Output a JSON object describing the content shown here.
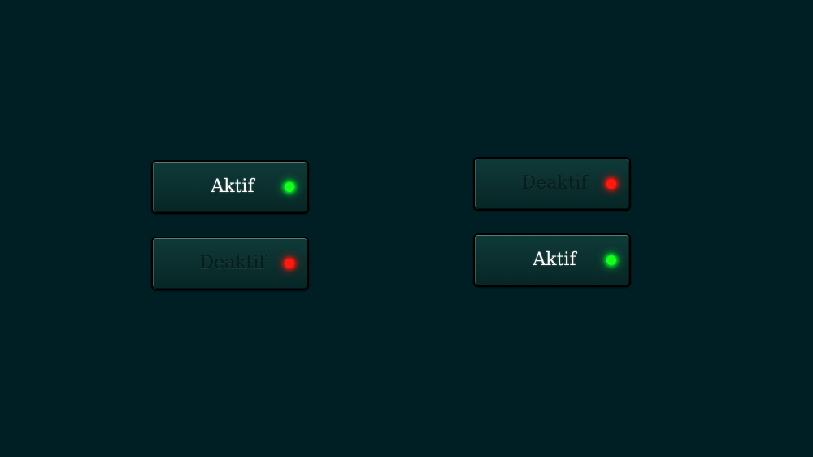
{
  "buttons": [
    {
      "label": "Aktif",
      "state": "active",
      "indicator": "green-led-icon",
      "color": "#16ff1c"
    },
    {
      "label": "Deaktif",
      "state": "inactive",
      "indicator": "red-led-icon",
      "color": "#ff1a10"
    },
    {
      "label": "Deaktif",
      "state": "inactive",
      "indicator": "red-led-icon",
      "color": "#ff1a10"
    },
    {
      "label": "Aktif",
      "state": "active",
      "indicator": "green-led-icon",
      "color": "#16ff1c"
    }
  ],
  "colors": {
    "background": "#001f24",
    "button_face": "#0b2f2e",
    "active_text": "#ffffff",
    "inactive_text": "#071c1c"
  }
}
